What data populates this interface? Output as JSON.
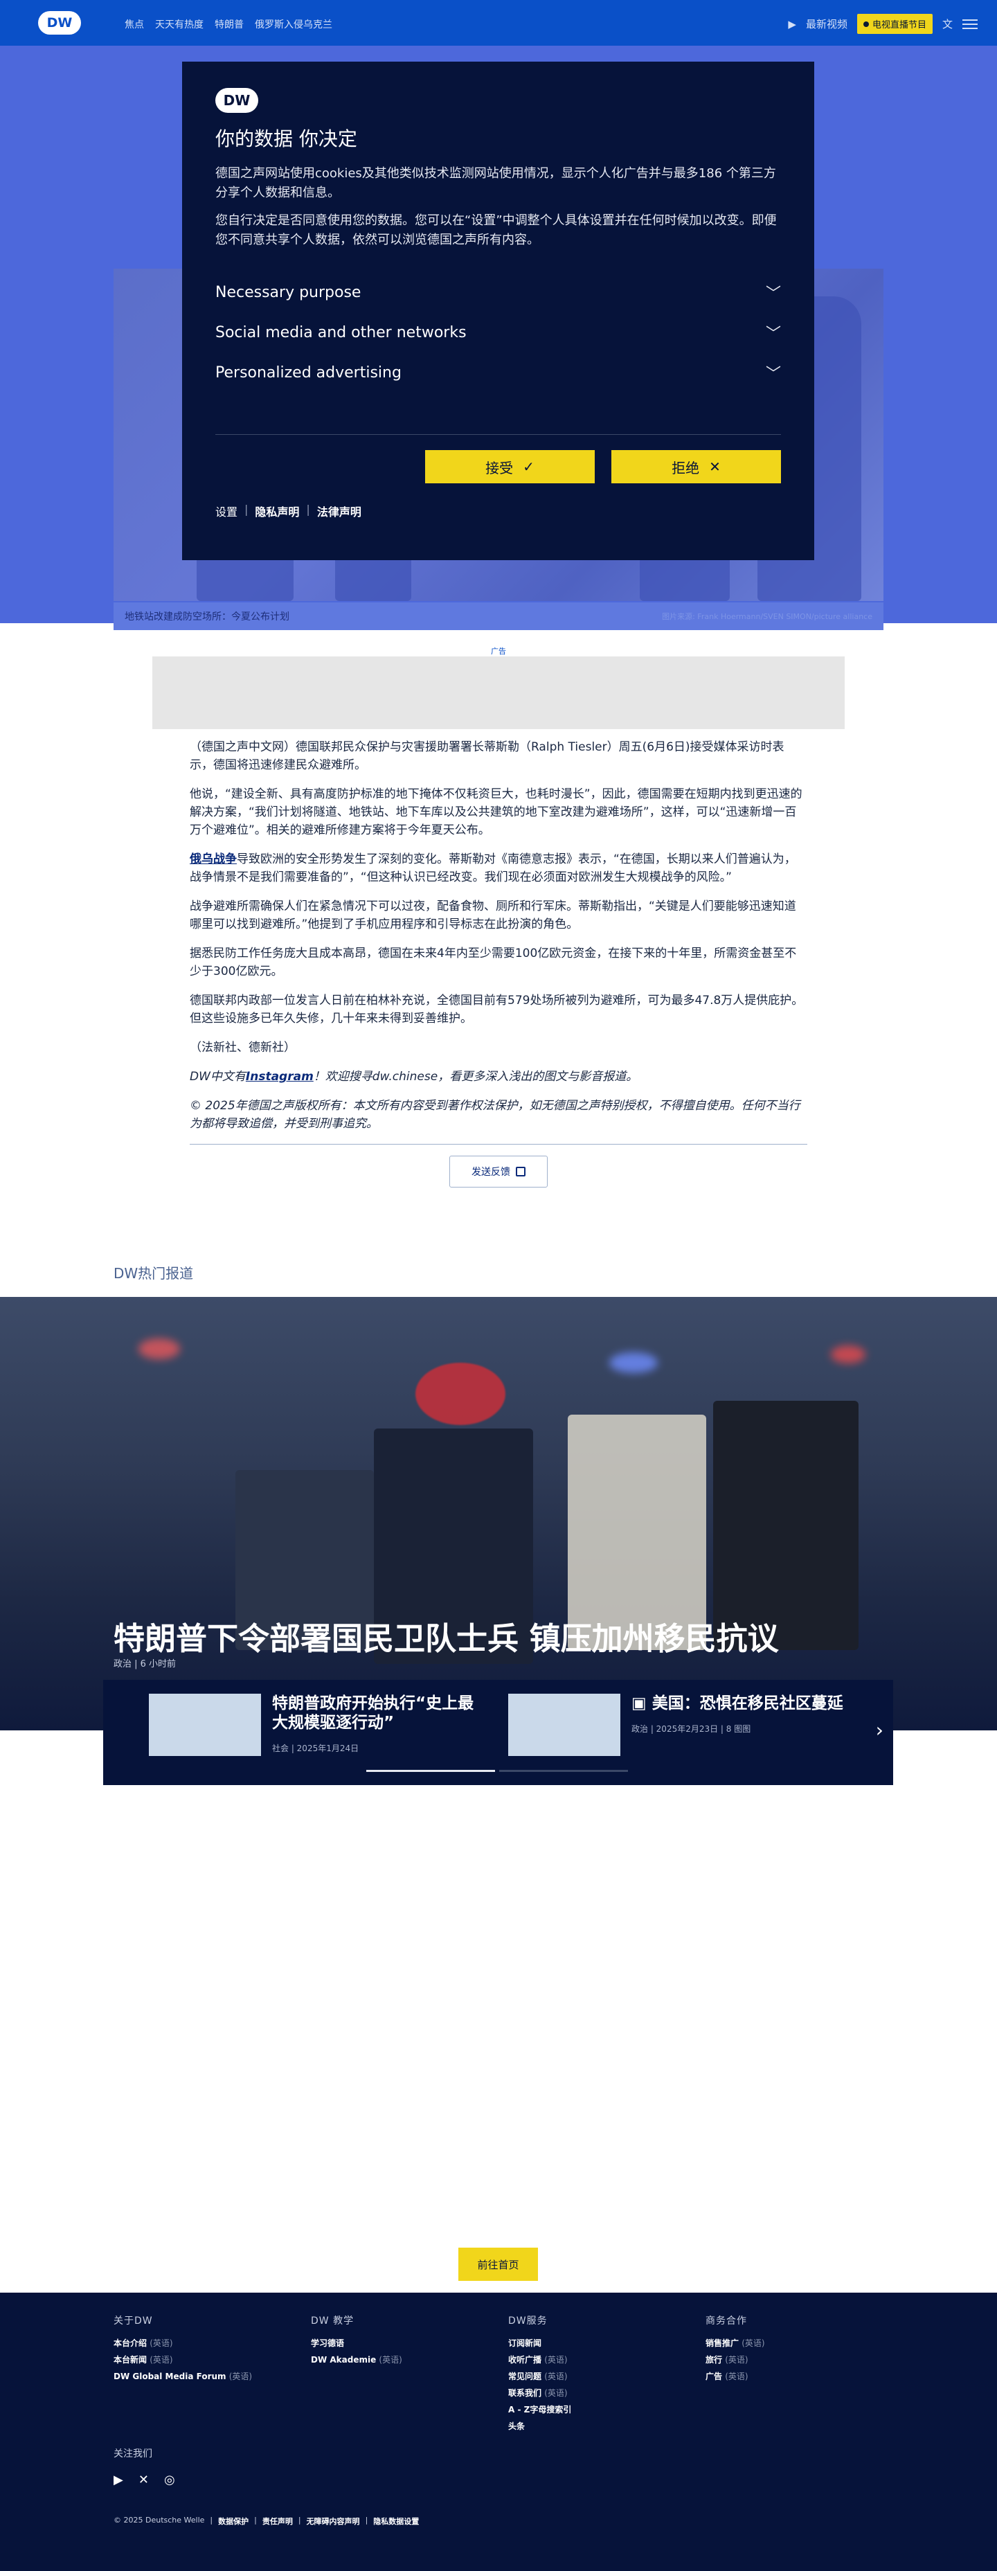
{
  "header": {
    "logo": "DW",
    "nav": [
      "焦点",
      "天天有热度",
      "特朗普",
      "俄罗斯入侵乌克兰"
    ],
    "latest_video": "最新视频",
    "tv_program": "电视直播节目",
    "lang_icon": "文"
  },
  "cookie": {
    "logo": "DW",
    "title": "你的数据 你决定",
    "p1": "德国之声网站使用cookies及其他类似技术监测网站使用情况，显示个人化广告并与最多186 个第三方分享个人数据和信息。",
    "p2": "您自行决定是否同意使用您的数据。您可以在“设置”中调整个人具体设置并在任何时候加以改变。即便您不同意共享个人数据，依然可以浏览德国之声所有内容。",
    "sections": [
      "Necessary purpose",
      "Social media and other networks",
      "Personalized advertising"
    ],
    "accept": "接受",
    "reject": "拒绝",
    "links": [
      "设置",
      "隐私声明",
      "法律声明"
    ]
  },
  "hero": {
    "caption": "地铁站改建成防空场所：今夏公布计划",
    "credit": "图片来源: Frank Hoermann/SVEN SIMON/picture alliance"
  },
  "ad_label": "广告",
  "article": {
    "p1": "（德国之声中文网）德国联邦民众保护与灾害援助署署长蒂斯勒（Ralph Tiesler）周五(6月6日)接受媒体采访时表示，德国将迅速修建民众避难所。",
    "p2": "他说，“建设全新、具有高度防护标准的地下掩体不仅耗资巨大，也耗时漫长”，因此，德国需要在短期内找到更迅速的解决方案，“我们计划将隧道、地铁站、地下车库以及公共建筑的地下室改建为避难场所”，这样，可以“迅速新增一百万个避难位”。相关的避难所修建方案将于今年夏天公布。",
    "p3_link": "俄乌战争",
    "p3": "导致欧洲的安全形势发生了深刻的变化。蒂斯勒对《南德意志报》表示，“在德国，长期以来人们普遍认为，战争情景不是我们需要准备的”，“但这种认识已经改变。我们现在必须面对欧洲发生大规模战争的风险。”",
    "p4": "战争避难所需确保人们在紧急情况下可以过夜，配备食物、厕所和行军床。蒂斯勒指出，“关键是人们要能够迅速知道哪里可以找到避难所。”他提到了手机应用程序和引导标志在此扮演的角色。",
    "p5": "据悉民防工作任务庞大且成本高昂，德国在未来4年内至少需要100亿欧元资金，在接下来的十年里，所需资金甚至不少于300亿欧元。",
    "p6": "德国联邦内政部一位发言人日前在柏林补充说，全德国目前有579处场所被列为避难所，可为最多47.8万人提供庇护。但这些设施多已年久失修，几十年来未得到妥善维护。",
    "p7": "（法新社、德新社）",
    "p8_pre": "DW中文有",
    "p8_link": "Instagram",
    "p8_post": "！欢迎搜寻dw.chinese，看更多深入浅出的图文与影音报道。",
    "p9": "© 2025年德国之声版权所有：本文所有内容受到著作权法保护，如无德国之声特别授权，不得擅自使用。任何不当行为都将导致追偿，并受到刑事追究。",
    "feedback": "发送反馈"
  },
  "hot": {
    "section_title": "DW热门报道",
    "feature_title": "特朗普下令部署国民卫队士兵 镇压加州移民抗议",
    "feature_meta": "政治 | 6 小时前",
    "cards": [
      {
        "title": "特朗普政府开始执行“史上最大规模驱逐行动”",
        "meta": "社会 | 2025年1月24日"
      },
      {
        "title": "美国：恐惧在移民社区蔓延",
        "meta": "政治 | 2025年2月23日 | 8 图图"
      }
    ]
  },
  "home_button": "前往首页",
  "footer": {
    "cols": [
      {
        "title": "关于DW",
        "links": [
          {
            "t": "本台介绍",
            "s": "(英语)"
          },
          {
            "t": "本台新闻",
            "s": "(英语)"
          },
          {
            "t": "DW Global Media Forum",
            "s": "(英语)"
          }
        ]
      },
      {
        "title": "DW 教学",
        "links": [
          {
            "t": "学习德语",
            "s": ""
          },
          {
            "t": "DW Akademie",
            "s": "(英语)"
          }
        ]
      },
      {
        "title": "DW服务",
        "links": [
          {
            "t": "订阅新闻",
            "s": ""
          },
          {
            "t": "收听广播",
            "s": "(英语)"
          },
          {
            "t": "常见问题",
            "s": "(英语)"
          },
          {
            "t": "联系我们",
            "s": "(英语)"
          },
          {
            "t": "A - Z字母搜索引",
            "s": ""
          },
          {
            "t": "头条",
            "s": ""
          }
        ]
      },
      {
        "title": "商务合作",
        "links": [
          {
            "t": "销售推广",
            "s": "(英语)"
          },
          {
            "t": "旅行",
            "s": "(英语)"
          },
          {
            "t": "广告",
            "s": "(英语)"
          }
        ]
      }
    ],
    "follow": "关注我们",
    "legal": [
      "© 2025 Deutsche Welle",
      "数据保护",
      "责任声明",
      "无障碍内容声明",
      "隐私数据设置"
    ]
  }
}
